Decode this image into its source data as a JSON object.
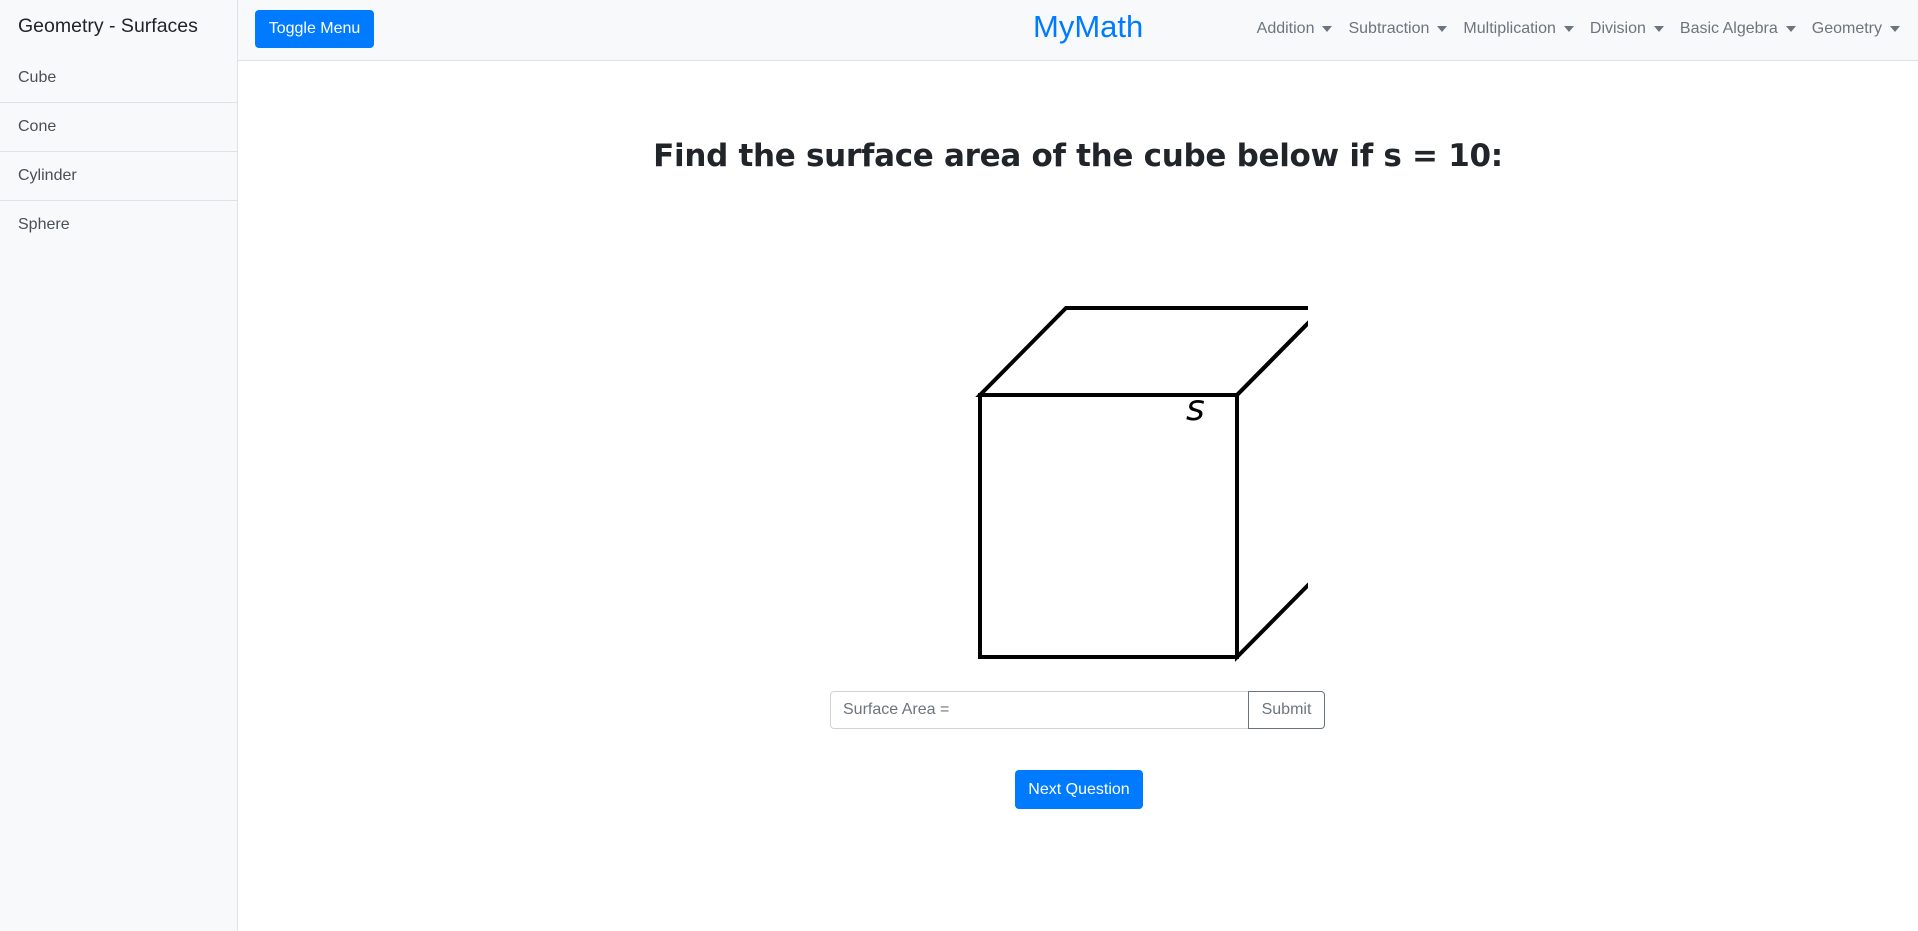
{
  "sidebar": {
    "heading": "Geometry - Surfaces",
    "items": [
      {
        "label": "Cube"
      },
      {
        "label": "Cone"
      },
      {
        "label": "Cylinder"
      },
      {
        "label": "Sphere"
      }
    ]
  },
  "topbar": {
    "toggle_label": "Toggle Menu",
    "brand": "MyMath",
    "nav": [
      {
        "label": "Addition"
      },
      {
        "label": "Subtraction"
      },
      {
        "label": "Multiplication"
      },
      {
        "label": "Division"
      },
      {
        "label": "Basic Algebra"
      },
      {
        "label": "Geometry"
      }
    ]
  },
  "main": {
    "question": "Find the surface area of the cube below if s = 10:",
    "figure": {
      "shape": "cube",
      "side_label": "s"
    },
    "answer": {
      "placeholder": "Surface Area =",
      "value": "",
      "submit_label": "Submit"
    },
    "next_label": "Next Question"
  },
  "colors": {
    "primary": "#007bff",
    "navbar_bg": "#f8f9fa",
    "muted_text": "#6c757d",
    "border": "#dee2e6"
  }
}
